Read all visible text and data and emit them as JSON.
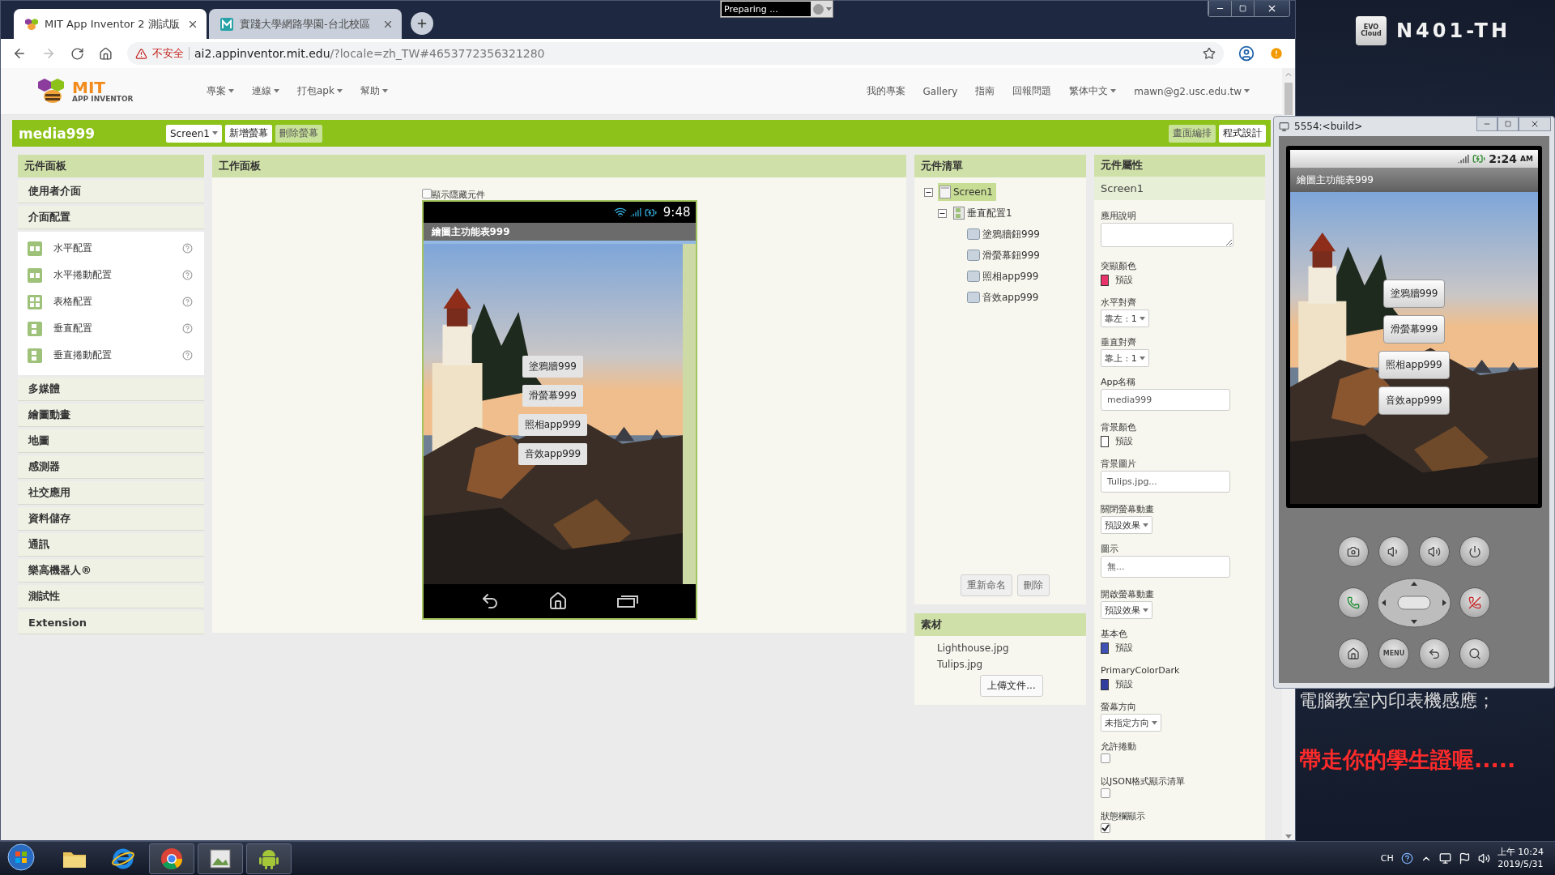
{
  "desktop": {
    "host_label": "N401-TH",
    "logo_lines": [
      "EVO",
      "Cloud"
    ],
    "notice_lines": [
      {
        "text": "電腦教室內印表機感應；",
        "kind": "plain"
      },
      {
        "text": "帶走你的學生證喔.....",
        "kind": "alert"
      }
    ]
  },
  "progress_popup": {
    "text": "Preparing ..."
  },
  "browser": {
    "tabs": [
      {
        "title": "MIT App Inventor 2 測試版",
        "selected": true
      },
      {
        "title": "實踐大學網路學園-台北校區",
        "selected": false
      }
    ],
    "security_label": "不安全",
    "url_host": "ai2.appinventor.mit.edu",
    "url_rest": "/?locale=zh_TW#4653772356321280"
  },
  "app_header": {
    "logo_title": "MIT",
    "logo_subtitle": "APP INVENTOR",
    "menu": [
      {
        "label": "專案",
        "dropdown": true
      },
      {
        "label": "連線",
        "dropdown": true
      },
      {
        "label": "打包apk",
        "dropdown": true
      },
      {
        "label": "幫助",
        "dropdown": true
      }
    ],
    "right_menu": [
      {
        "label": "我的專案",
        "dropdown": false
      },
      {
        "label": "Gallery",
        "dropdown": false
      },
      {
        "label": "指南",
        "dropdown": false
      },
      {
        "label": "回報問題",
        "dropdown": false
      },
      {
        "label": "繁体中文",
        "dropdown": true
      },
      {
        "label": "mawn@g2.usc.edu.tw",
        "dropdown": true
      }
    ]
  },
  "project_bar": {
    "name": "media999",
    "screen_select": "Screen1",
    "buttons": [
      {
        "label": "新增螢幕",
        "disabled": false
      },
      {
        "label": "刪除螢幕",
        "disabled": true
      }
    ],
    "views": [
      {
        "label": "畫面編排",
        "selected": true
      },
      {
        "label": "程式設計",
        "selected": false
      }
    ]
  },
  "palette": {
    "title": "元件面板",
    "categories": [
      {
        "label": "使用者介面"
      },
      {
        "label": "介面配置",
        "items": [
          {
            "label": "水平配置",
            "kind": "horizontal"
          },
          {
            "label": "水平捲動配置",
            "kind": "horizontal"
          },
          {
            "label": "表格配置",
            "kind": "table"
          },
          {
            "label": "垂直配置",
            "kind": "vertical"
          },
          {
            "label": "垂直捲動配置",
            "kind": "vertical"
          }
        ]
      },
      {
        "label": "多媒體"
      },
      {
        "label": "繪圖動畫"
      },
      {
        "label": "地圖"
      },
      {
        "label": "感測器"
      },
      {
        "label": "社交應用"
      },
      {
        "label": "資料儲存"
      },
      {
        "label": "通訊"
      },
      {
        "label": "樂高機器人®"
      },
      {
        "label": "測試性"
      },
      {
        "label": "Extension"
      }
    ]
  },
  "viewer": {
    "title": "工作面板",
    "show_hidden": {
      "label": "顯示隱藏元件",
      "checked": false
    },
    "phone": {
      "time": "9:48",
      "screen_title": "繪圖主功能表999",
      "buttons": [
        "塗鴉牆999",
        "滑螢幕999",
        "照相app999",
        "音效app999"
      ]
    }
  },
  "components": {
    "title": "元件清單",
    "tree": [
      {
        "label": "Screen1",
        "kind": "screen",
        "selected": true,
        "expanded": true,
        "children": [
          {
            "label": "垂直配置1",
            "kind": "arrangement",
            "selected": false,
            "expanded": true,
            "children": [
              {
                "label": "塗鴉牆鈕999",
                "kind": "button",
                "selected": false
              },
              {
                "label": "滑螢幕鈕999",
                "kind": "button",
                "selected": false
              },
              {
                "label": "照相app999",
                "kind": "button",
                "selected": false
              },
              {
                "label": "音效app999",
                "kind": "button",
                "selected": false
              }
            ]
          }
        ]
      }
    ],
    "actions": [
      "重新命名",
      "刪除"
    ]
  },
  "media": {
    "title": "素材",
    "files": [
      "Lighthouse.jpg",
      "Tulips.jpg"
    ],
    "upload": "上傳文件..."
  },
  "properties": {
    "title": "元件屬性",
    "component": "Screen1",
    "items": [
      {
        "label": "應用說明",
        "kind": "textarea"
      },
      {
        "label": "突顯顏色",
        "kind": "color",
        "color": "#e8336b",
        "value": "預設"
      },
      {
        "label": "水平對齊",
        "kind": "dropdown",
        "value": "靠左 : 1"
      },
      {
        "label": "垂直對齊",
        "kind": "dropdown",
        "value": "靠上 : 1"
      },
      {
        "label": "App名稱",
        "kind": "text",
        "value": "media999"
      },
      {
        "label": "背景顏色",
        "kind": "color",
        "color": "#ffffff",
        "value": "預設"
      },
      {
        "label": "背景圖片",
        "kind": "text",
        "value": "Tulips.jpg..."
      },
      {
        "label": "關閉螢幕動畫",
        "kind": "dropdown",
        "value": "預設效果"
      },
      {
        "label": "圖示",
        "kind": "text",
        "value": "無..."
      },
      {
        "label": "開啟螢幕動畫",
        "kind": "dropdown",
        "value": "預設效果"
      },
      {
        "label": "基本色",
        "kind": "color",
        "color": "#3f51b5",
        "value": "預設"
      },
      {
        "label": "PrimaryColorDark",
        "kind": "color",
        "color": "#303f9f",
        "value": "預設"
      },
      {
        "label": "螢幕方向",
        "kind": "dropdown",
        "value": "未指定方向"
      },
      {
        "label": "允許捲動",
        "kind": "checkbox",
        "checked": false
      },
      {
        "label": "以JSON格式顯示清單",
        "kind": "checkbox",
        "checked": false
      },
      {
        "label": "狀態欄顯示",
        "kind": "checkbox",
        "checked": true
      }
    ]
  },
  "emulator": {
    "title": "5554:<build>",
    "time": "2:24",
    "time_suffix": "AM",
    "screen_title": "繪圖主功能表999",
    "buttons": [
      "塗鴉牆999",
      "滑螢幕999",
      "照相app999",
      "音效app999"
    ],
    "menu_key": "MENU"
  },
  "taskbar": {
    "language": "CH",
    "time": "上午 10:24",
    "date": "2019/5/31"
  }
}
